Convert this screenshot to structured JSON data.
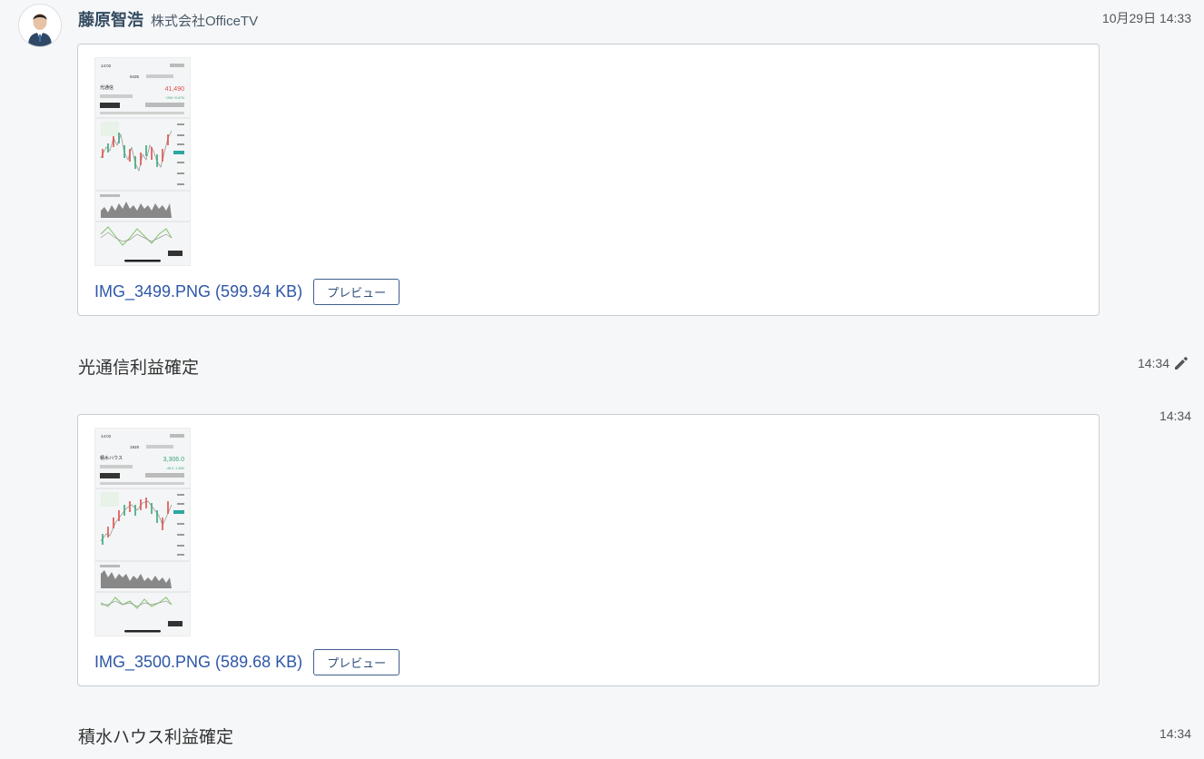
{
  "sender": {
    "name": "藤原智浩",
    "company": "株式会社OfficeTV",
    "avatar_icon": "person-avatar-icon"
  },
  "messages": [
    {
      "time": "10月29日 14:33",
      "attachment": {
        "file_label": "IMG_3499.PNG (599.94 KB)",
        "preview_label": "プレビュー",
        "thumb": {
          "clock": "14:02",
          "code": "9435",
          "name": "光通信",
          "price": "41,490",
          "change": "+290  +0.67%",
          "price_color": "#e0504a"
        }
      }
    },
    {
      "time": "14:34",
      "text": "光通信利益確定",
      "edit_icon": "pencil-icon"
    },
    {
      "time": "14:34",
      "attachment": {
        "file_label": "IMG_3500.PNG (589.68 KB)",
        "preview_label": "プレビュー",
        "thumb": {
          "clock": "14:02",
          "code": "1928",
          "name": "積水ハウス",
          "price": "3,306.0",
          "change": "-48.0  -1.43%",
          "price_color": "#3aa67a"
        }
      }
    },
    {
      "time": "14:34",
      "text": "積水ハウス利益確定"
    }
  ]
}
